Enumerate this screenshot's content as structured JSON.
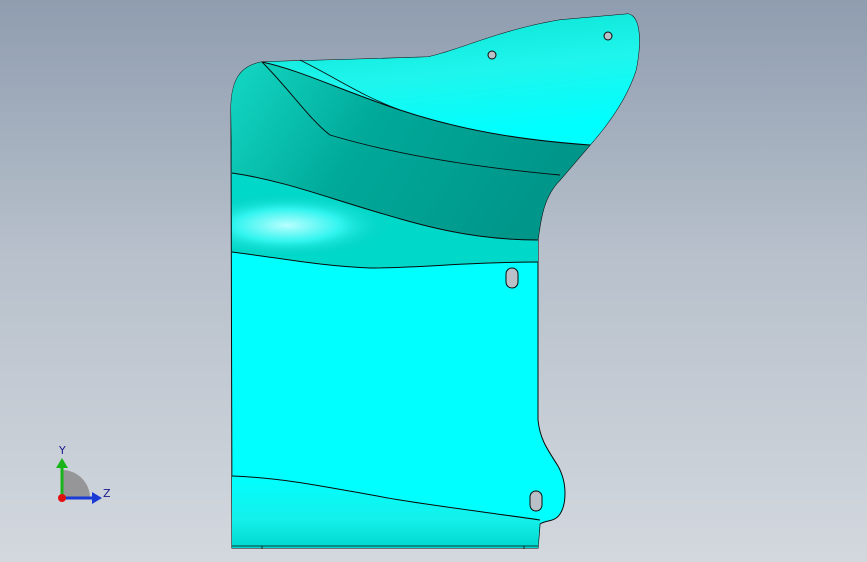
{
  "triad": {
    "y_label": "Y",
    "z_label": "Z",
    "colors": {
      "y_axis": "#19b419",
      "z_axis": "#1a3ad6",
      "x_dot": "#e01010"
    }
  },
  "part": {
    "color": "#00ffff",
    "shade_color": "#00b3a2",
    "edge_color": "#0a0a0a"
  }
}
